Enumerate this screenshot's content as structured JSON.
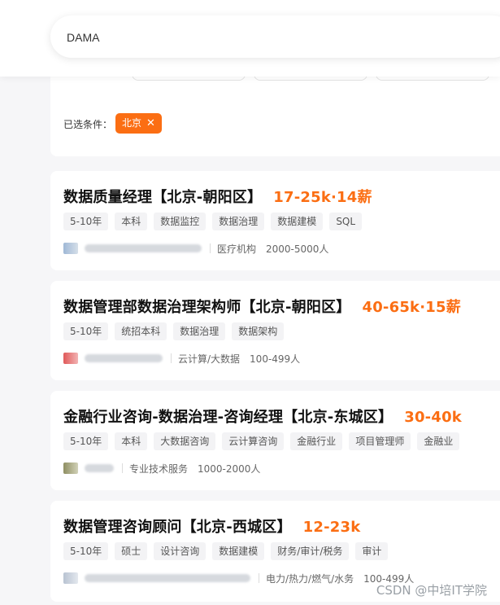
{
  "search": {
    "value": "DAMA"
  },
  "filters": {
    "selected_label": "已选条件：",
    "selected_tag": "北京",
    "remove_glyph": "✕",
    "tag_color": "#fb6e13"
  },
  "jobs": [
    {
      "title": "数据质量经理【北京-朝阳区】",
      "salary": "17-25k·14薪",
      "tags": [
        "5-10年",
        "本科",
        "数据监控",
        "数据治理",
        "数据建模",
        "SQL"
      ],
      "industry": "医疗机构",
      "size": "2000-5000人"
    },
    {
      "title": "数据管理部数据治理架构师【北京-朝阳区】",
      "salary": "40-65k·15薪",
      "tags": [
        "5-10年",
        "统招本科",
        "数据治理",
        "数据架构"
      ],
      "industry": "云计算/大数据",
      "size": "100-499人"
    },
    {
      "title": "金融行业咨询-数据治理-咨询经理【北京-东城区】",
      "salary": "30-40k",
      "tags": [
        "5-10年",
        "本科",
        "大数据咨询",
        "云计算咨询",
        "金融行业",
        "项目管理师",
        "金融业"
      ],
      "industry": "专业技术服务",
      "size": "1000-2000人"
    },
    {
      "title": "数据管理咨询顾问【北京-西城区】",
      "salary": "12-23k",
      "tags": [
        "5-10年",
        "硕士",
        "设计咨询",
        "数据建模",
        "财务/审计/税务",
        "审计"
      ],
      "industry": "电力/热力/燃气/水务",
      "size": "100-499人"
    }
  ],
  "watermark": "CSDN @中培IT学院",
  "colors": {
    "accent": "#fb6e13",
    "background": "#f6f6f8"
  }
}
